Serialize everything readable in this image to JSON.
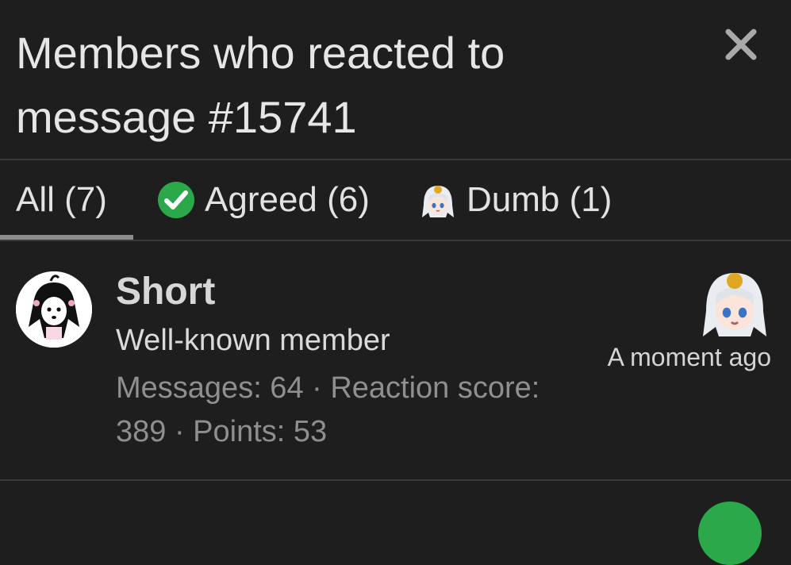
{
  "dialog": {
    "title": "Members who reacted to message #15741",
    "close_icon": "close-icon"
  },
  "tabs": [
    {
      "label": "All (7)",
      "active": true
    },
    {
      "label": "Agreed (6)",
      "icon": "check-circle-icon"
    },
    {
      "label": "Dumb (1)",
      "icon": "anime-face-icon"
    }
  ],
  "members": [
    {
      "name": "Short",
      "title": "Well-known member",
      "stats": "Messages: 64 · Reaction score: 389 · Points: 53",
      "reaction_icon": "anime-face-icon",
      "time": "A moment ago"
    }
  ],
  "colors": {
    "background": "#1e1e1e",
    "divider": "#3a3a3a",
    "agreed_green": "#2aa84a",
    "muted_text": "#8f8f8f"
  }
}
